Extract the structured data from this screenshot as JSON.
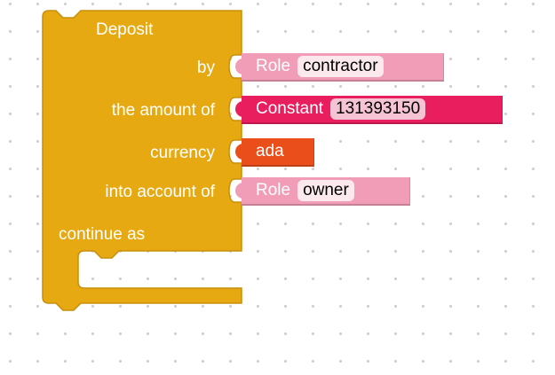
{
  "colors": {
    "deposit_block": "#e7a912",
    "role_block": "#f19db7",
    "constant_block": "#e91e5f",
    "currency_block": "#e94e1b",
    "workspace_dots": "#cfcfcf"
  },
  "deposit": {
    "title": "Deposit",
    "by_label": "by",
    "amount_label": "the amount of",
    "currency_label": "currency",
    "into_label": "into account of",
    "continue_label": "continue as"
  },
  "by_role": {
    "kind": "Role",
    "value": "contractor"
  },
  "amount": {
    "kind": "Constant",
    "value": "131393150"
  },
  "currency": {
    "value": "ada"
  },
  "into_role": {
    "kind": "Role",
    "value": "owner"
  }
}
